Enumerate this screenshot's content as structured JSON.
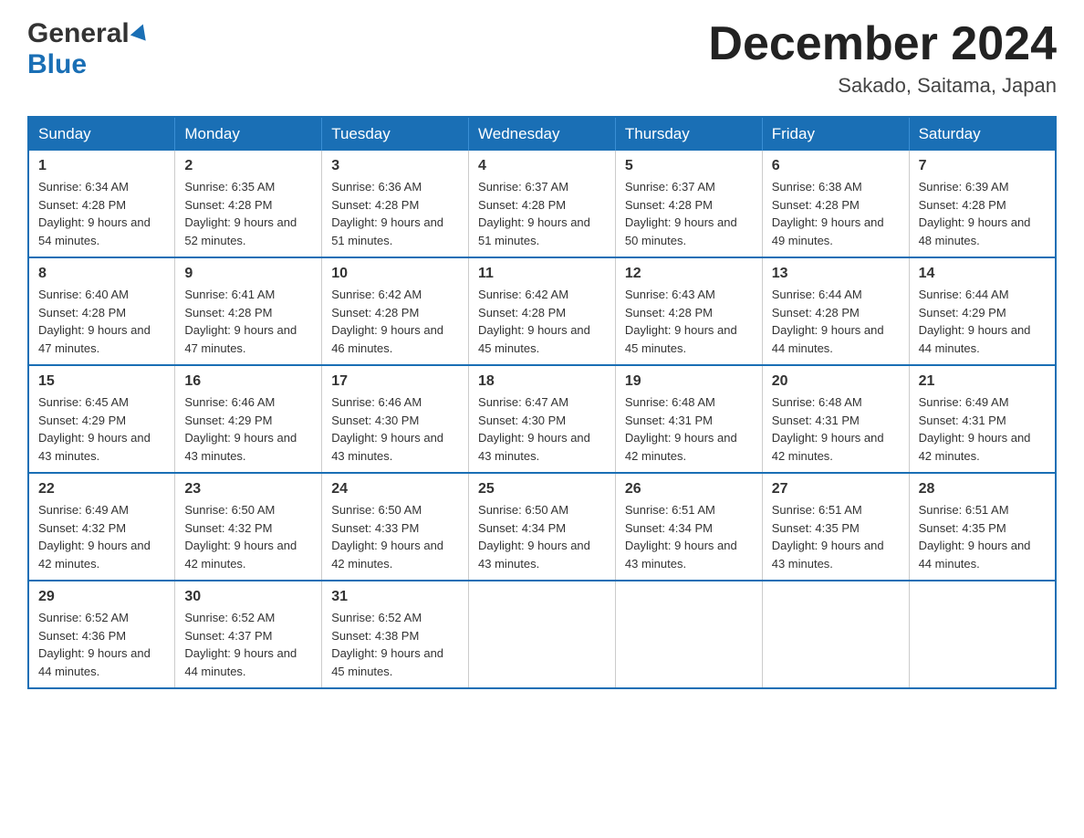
{
  "header": {
    "logo_general": "General",
    "logo_blue": "Blue",
    "month_title": "December 2024",
    "location": "Sakado, Saitama, Japan"
  },
  "calendar": {
    "days_of_week": [
      "Sunday",
      "Monday",
      "Tuesday",
      "Wednesday",
      "Thursday",
      "Friday",
      "Saturday"
    ],
    "weeks": [
      [
        {
          "day": "1",
          "sunrise": "6:34 AM",
          "sunset": "4:28 PM",
          "daylight": "9 hours and 54 minutes."
        },
        {
          "day": "2",
          "sunrise": "6:35 AM",
          "sunset": "4:28 PM",
          "daylight": "9 hours and 52 minutes."
        },
        {
          "day": "3",
          "sunrise": "6:36 AM",
          "sunset": "4:28 PM",
          "daylight": "9 hours and 51 minutes."
        },
        {
          "day": "4",
          "sunrise": "6:37 AM",
          "sunset": "4:28 PM",
          "daylight": "9 hours and 51 minutes."
        },
        {
          "day": "5",
          "sunrise": "6:37 AM",
          "sunset": "4:28 PM",
          "daylight": "9 hours and 50 minutes."
        },
        {
          "day": "6",
          "sunrise": "6:38 AM",
          "sunset": "4:28 PM",
          "daylight": "9 hours and 49 minutes."
        },
        {
          "day": "7",
          "sunrise": "6:39 AM",
          "sunset": "4:28 PM",
          "daylight": "9 hours and 48 minutes."
        }
      ],
      [
        {
          "day": "8",
          "sunrise": "6:40 AM",
          "sunset": "4:28 PM",
          "daylight": "9 hours and 47 minutes."
        },
        {
          "day": "9",
          "sunrise": "6:41 AM",
          "sunset": "4:28 PM",
          "daylight": "9 hours and 47 minutes."
        },
        {
          "day": "10",
          "sunrise": "6:42 AM",
          "sunset": "4:28 PM",
          "daylight": "9 hours and 46 minutes."
        },
        {
          "day": "11",
          "sunrise": "6:42 AM",
          "sunset": "4:28 PM",
          "daylight": "9 hours and 45 minutes."
        },
        {
          "day": "12",
          "sunrise": "6:43 AM",
          "sunset": "4:28 PM",
          "daylight": "9 hours and 45 minutes."
        },
        {
          "day": "13",
          "sunrise": "6:44 AM",
          "sunset": "4:28 PM",
          "daylight": "9 hours and 44 minutes."
        },
        {
          "day": "14",
          "sunrise": "6:44 AM",
          "sunset": "4:29 PM",
          "daylight": "9 hours and 44 minutes."
        }
      ],
      [
        {
          "day": "15",
          "sunrise": "6:45 AM",
          "sunset": "4:29 PM",
          "daylight": "9 hours and 43 minutes."
        },
        {
          "day": "16",
          "sunrise": "6:46 AM",
          "sunset": "4:29 PM",
          "daylight": "9 hours and 43 minutes."
        },
        {
          "day": "17",
          "sunrise": "6:46 AM",
          "sunset": "4:30 PM",
          "daylight": "9 hours and 43 minutes."
        },
        {
          "day": "18",
          "sunrise": "6:47 AM",
          "sunset": "4:30 PM",
          "daylight": "9 hours and 43 minutes."
        },
        {
          "day": "19",
          "sunrise": "6:48 AM",
          "sunset": "4:31 PM",
          "daylight": "9 hours and 42 minutes."
        },
        {
          "day": "20",
          "sunrise": "6:48 AM",
          "sunset": "4:31 PM",
          "daylight": "9 hours and 42 minutes."
        },
        {
          "day": "21",
          "sunrise": "6:49 AM",
          "sunset": "4:31 PM",
          "daylight": "9 hours and 42 minutes."
        }
      ],
      [
        {
          "day": "22",
          "sunrise": "6:49 AM",
          "sunset": "4:32 PM",
          "daylight": "9 hours and 42 minutes."
        },
        {
          "day": "23",
          "sunrise": "6:50 AM",
          "sunset": "4:32 PM",
          "daylight": "9 hours and 42 minutes."
        },
        {
          "day": "24",
          "sunrise": "6:50 AM",
          "sunset": "4:33 PM",
          "daylight": "9 hours and 42 minutes."
        },
        {
          "day": "25",
          "sunrise": "6:50 AM",
          "sunset": "4:34 PM",
          "daylight": "9 hours and 43 minutes."
        },
        {
          "day": "26",
          "sunrise": "6:51 AM",
          "sunset": "4:34 PM",
          "daylight": "9 hours and 43 minutes."
        },
        {
          "day": "27",
          "sunrise": "6:51 AM",
          "sunset": "4:35 PM",
          "daylight": "9 hours and 43 minutes."
        },
        {
          "day": "28",
          "sunrise": "6:51 AM",
          "sunset": "4:35 PM",
          "daylight": "9 hours and 44 minutes."
        }
      ],
      [
        {
          "day": "29",
          "sunrise": "6:52 AM",
          "sunset": "4:36 PM",
          "daylight": "9 hours and 44 minutes."
        },
        {
          "day": "30",
          "sunrise": "6:52 AM",
          "sunset": "4:37 PM",
          "daylight": "9 hours and 44 minutes."
        },
        {
          "day": "31",
          "sunrise": "6:52 AM",
          "sunset": "4:38 PM",
          "daylight": "9 hours and 45 minutes."
        },
        null,
        null,
        null,
        null
      ]
    ]
  }
}
